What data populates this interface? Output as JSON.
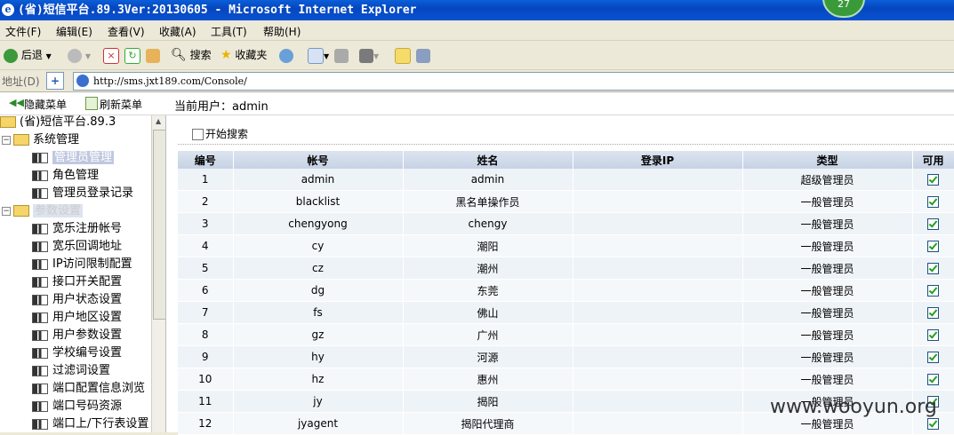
{
  "window": {
    "title": "(省)短信平台.89.3Ver:20130605 - Microsoft Internet Explorer",
    "badge": "27"
  },
  "menu": [
    "文件(F)",
    "编辑(E)",
    "查看(V)",
    "收藏(A)",
    "工具(T)",
    "帮助(H)"
  ],
  "toolbar": {
    "back": "后退",
    "search": "搜索",
    "favorites": "收藏夹"
  },
  "address": {
    "label": "地址(D)",
    "url": "http://sms.jxt189.com/Console/"
  },
  "frame": {
    "hide_menu": "隐藏菜单",
    "refresh_menu": "刷新菜单",
    "current_user": "当前用户：admin"
  },
  "tree": {
    "root": "(省)短信平台.89.3",
    "system": {
      "label": "系统管理",
      "items": [
        "管理员管理",
        "角色管理",
        "管理员登录记录"
      ]
    },
    "params": {
      "label": "参数设置",
      "items": [
        "宽乐注册帐号",
        "宽乐回调地址",
        "IP访问限制配置",
        "接口开关配置",
        "用户状态设置",
        "用户地区设置",
        "用户参数设置",
        "学校编号设置",
        "过滤词设置",
        "端口配置信息浏览",
        "端口号码资源",
        "端口上/下行表设置"
      ]
    }
  },
  "search": {
    "label": "开始搜索"
  },
  "table": {
    "headers": [
      "编号",
      "帐号",
      "姓名",
      "登录IP",
      "类型",
      "可用"
    ],
    "rows": [
      [
        "1",
        "admin",
        "admin",
        "",
        "超级管理员"
      ],
      [
        "2",
        "blacklist",
        "黑名单操作员",
        "",
        "一般管理员"
      ],
      [
        "3",
        "chengyong",
        "chengy",
        "",
        "一般管理员"
      ],
      [
        "4",
        "cy",
        "潮阳",
        "",
        "一般管理员"
      ],
      [
        "5",
        "cz",
        "潮州",
        "",
        "一般管理员"
      ],
      [
        "6",
        "dg",
        "东莞",
        "",
        "一般管理员"
      ],
      [
        "7",
        "fs",
        "佛山",
        "",
        "一般管理员"
      ],
      [
        "8",
        "gz",
        "广州",
        "",
        "一般管理员"
      ],
      [
        "9",
        "hy",
        "河源",
        "",
        "一般管理员"
      ],
      [
        "10",
        "hz",
        "惠州",
        "",
        "一般管理员"
      ],
      [
        "11",
        "jy",
        "揭阳",
        "",
        "一般管理员"
      ],
      [
        "12",
        "jyagent",
        "揭阳代理商",
        "",
        "一般管理员"
      ]
    ]
  },
  "watermark": "www.wooyun.org"
}
